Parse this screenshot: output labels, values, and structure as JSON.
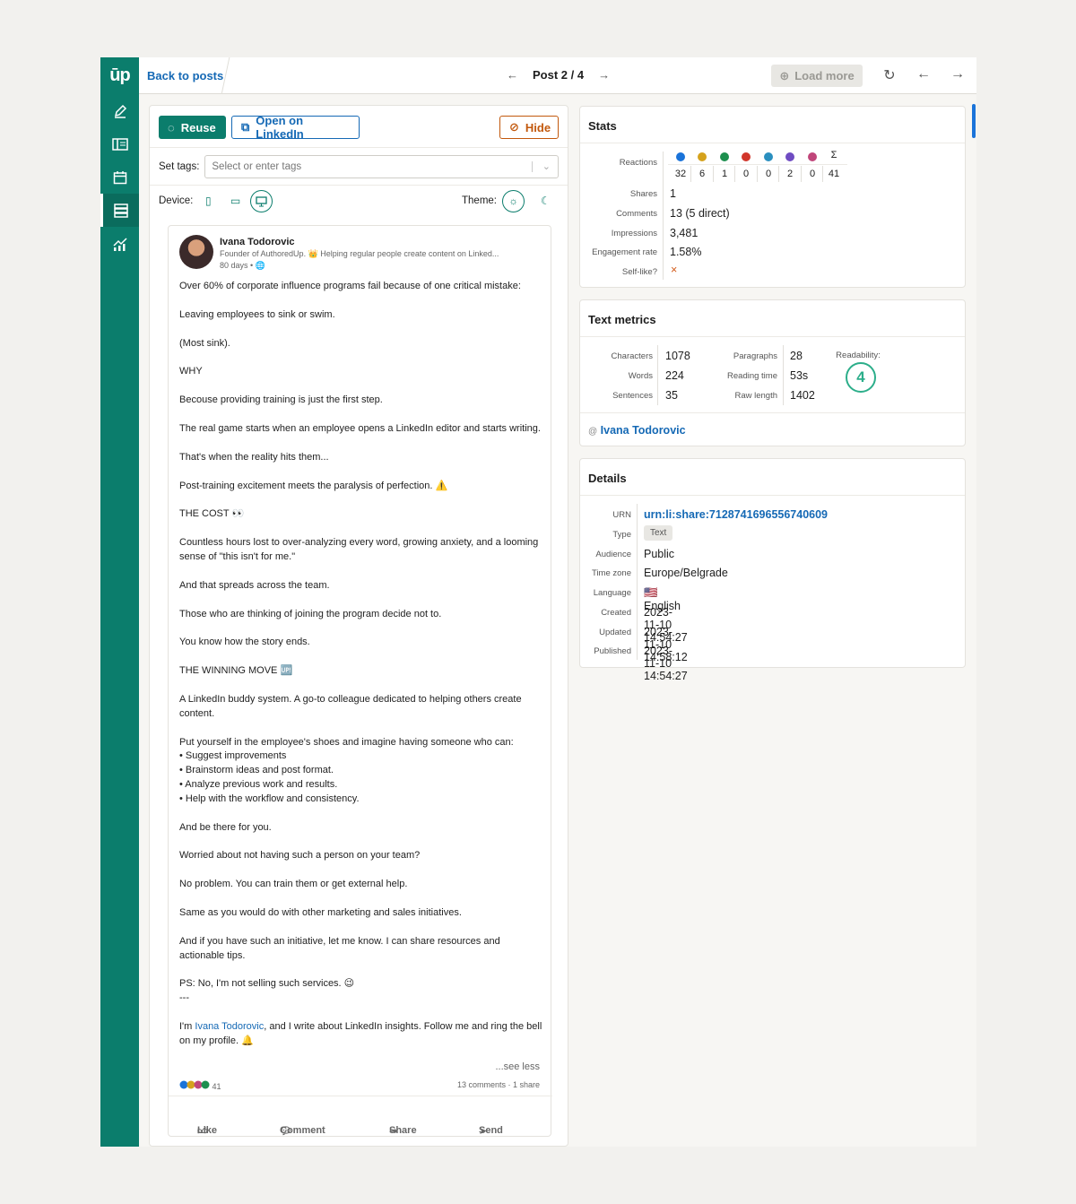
{
  "topbar": {
    "back_label": "Back to posts",
    "post_counter": "Post 2 / 4",
    "load_more_label": "Load more"
  },
  "toolbar": {
    "reuse_label": "Reuse",
    "open_label": "Open on LinkedIn",
    "hide_label": "Hide",
    "set_tags_label": "Set tags:",
    "tags_placeholder": "Select or enter tags",
    "device_label": "Device:",
    "theme_label": "Theme:"
  },
  "post": {
    "author": "Ivana Todorovic",
    "subtitle": "Founder of AuthoredUp. 👑 Helping regular people create content on Linked...",
    "age": "80 days •",
    "paragraphs": [
      "Over 60% of corporate influence programs fail because of one critical mistake:",
      "Leaving employees to sink or swim.",
      "(Most sink).",
      "WHY",
      "Becouse providing training is just the first step.",
      "The real game starts when an employee opens a LinkedIn editor and starts writing.",
      "That's when the reality hits them...",
      "Post-training excitement meets the paralysis of perfection. ⚠️",
      "THE COST 👀",
      "Countless hours lost to over-analyzing every word, growing anxiety, and a looming sense of \"this isn't for me.\"",
      "And that spreads across the team.",
      "Those who are thinking of joining the program decide not to.",
      "You know how the story ends.",
      "THE WINNING MOVE 🆙",
      "A LinkedIn buddy system. A go-to colleague dedicated to helping others create content.",
      "Put yourself in the employee's shoes and imagine having someone who can:\n• Suggest improvements\n• Brainstorm ideas and post format.\n• Analyze previous work and results.\n• Help with the workflow and consistency.",
      "And be there for you.",
      "Worried about not having such a person on your team?",
      "No problem. You can train them or get external help.",
      "Same as you would do with other marketing and sales initiatives.",
      "And if you have such an initiative, let me know. I can share resources and actionable tips.",
      "PS: No, I'm not selling such services. 😉\n---"
    ],
    "closing_before": "I'm ",
    "closing_mention": "Ivana Todorovic",
    "closing_after": ", and I write about LinkedIn insights. Follow me and ring the bell on my profile. 🔔",
    "see_less": "...see less",
    "reaction_count": "41",
    "comments_shares": "13 comments · 1 share",
    "actions": {
      "like": "Like",
      "comment": "Comment",
      "share": "Share",
      "send": "Send"
    }
  },
  "stats": {
    "title": "Stats",
    "reactions_label": "Reactions",
    "reaction_values": [
      "32",
      "6",
      "1",
      "0",
      "0",
      "2",
      "0",
      "41"
    ],
    "reaction_sum_symbol": "Σ",
    "shares_label": "Shares",
    "shares": "1",
    "comments_label": "Comments",
    "comments": "13 (5 direct)",
    "impressions_label": "Impressions",
    "impressions": "3,481",
    "engagement_label": "Engagement rate",
    "engagement": "1.58%",
    "selflike_label": "Self-like?",
    "selflike": "×",
    "colors": [
      "#1a73d9",
      "#d5a21c",
      "#1d8f4e",
      "#d1362b",
      "#2a8fbf",
      "#6f4cc2",
      "#c0457a"
    ]
  },
  "text_metrics": {
    "title": "Text metrics",
    "characters_label": "Characters",
    "characters": "1078",
    "words_label": "Words",
    "words": "224",
    "sentences_label": "Sentences",
    "sentences": "35",
    "paragraphs_label": "Paragraphs",
    "paragraphs": "28",
    "reading_time_label": "Reading time",
    "reading_time": "53s",
    "raw_length_label": "Raw length",
    "raw_length": "1402",
    "readability_label": "Readability:",
    "readability": "4",
    "author_at": "@",
    "author": "Ivana Todorovic"
  },
  "details": {
    "title": "Details",
    "urn_label": "URN",
    "urn": "urn:li:share:7128741696556740609",
    "type_label": "Type",
    "type": "Text",
    "audience_label": "Audience",
    "audience": "Public",
    "timezone_label": "Time zone",
    "timezone": "Europe/Belgrade",
    "language_label": "Language",
    "language": "🇺🇸 English",
    "created_label": "Created",
    "created": "2023-11-10 14:54:27",
    "updated_label": "Updated",
    "updated": "2023-11-10 14:58:12",
    "published_label": "Published",
    "published": "2023-11-10 14:54:27"
  }
}
